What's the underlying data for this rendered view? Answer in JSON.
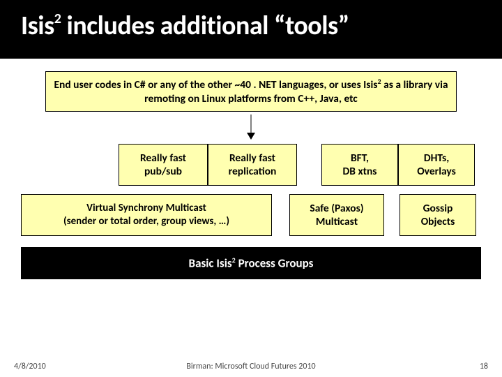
{
  "title_prefix": "Isis",
  "title_suffix": " includes additional “tools”",
  "top_box_a": "End user codes in C# or any of the other ~40 . NET languages, or uses Isis",
  "top_box_b": " as a library via remoting on Linux platforms from C++, Java, etc",
  "row2": {
    "pubsub_a": "Really fast",
    "pubsub_b": "pub/sub",
    "repl_a": "Really fast",
    "repl_b": "replication",
    "bft_a": "BFT,",
    "bft_b": "DB xtns",
    "dht_a": "DHTs,",
    "dht_b": "Overlays"
  },
  "row3": {
    "vsync_a": "Virtual Synchrony Multicast",
    "vsync_b": "(sender or total order, group views, …)",
    "paxos_a": "Safe (Paxos)",
    "paxos_b": "Multicast",
    "gossip_a": "Gossip",
    "gossip_b": "Objects"
  },
  "stack_a": "Basic Isis",
  "stack_b": " Process Groups",
  "footer": {
    "date": "4/8/2010",
    "center": "Birman: Microsoft Cloud Futures 2010",
    "page": "18"
  }
}
